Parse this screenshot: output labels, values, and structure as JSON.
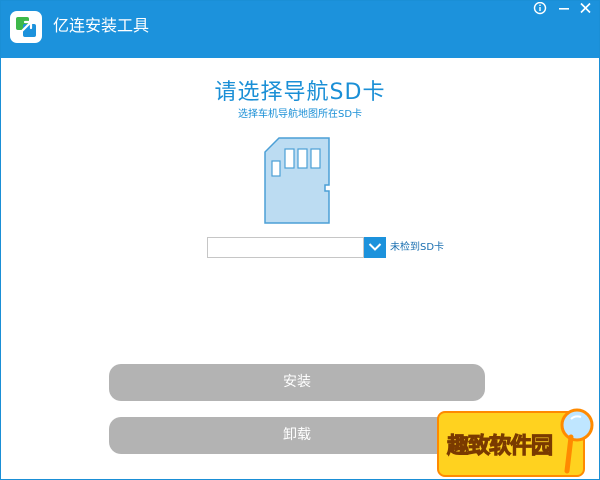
{
  "window": {
    "title": "亿连安装工具",
    "accent_color": "#1c92dc",
    "controls": {
      "info_icon": "info-icon",
      "minimize_icon": "minimize-icon",
      "close_icon": "close-icon"
    }
  },
  "main": {
    "heading": "请选择导航SD卡",
    "subheading": "选择车机导航地图所在SD卡",
    "illustration_icon": "sd-card-icon",
    "sd_select": {
      "value": "",
      "dropdown_icon": "chevron-down-icon"
    },
    "status": "未检到SD卡"
  },
  "actions": {
    "install_label": "安装",
    "uninstall_label": "卸载",
    "button_color": "#b3b3b3"
  },
  "watermark": {
    "text": "趣致软件园"
  }
}
